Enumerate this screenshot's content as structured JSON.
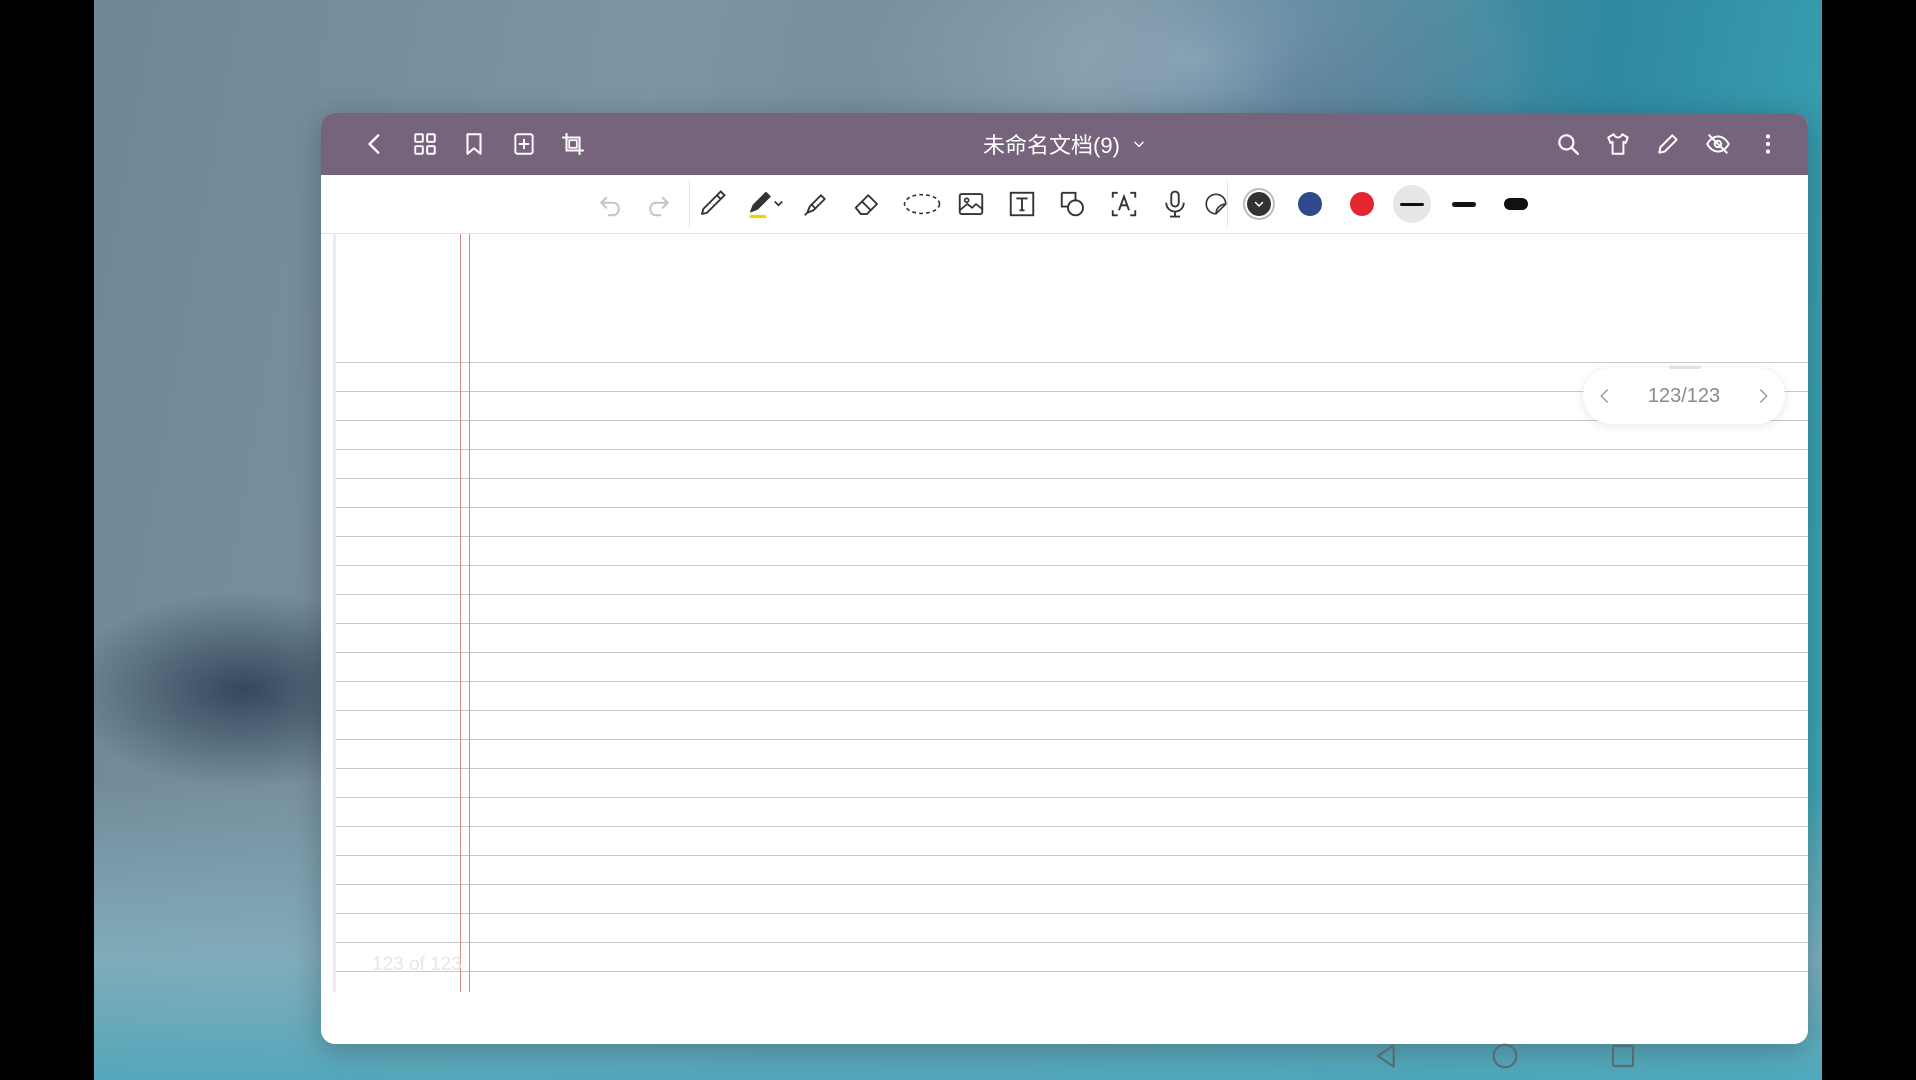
{
  "document": {
    "title": "未命名文档(9)"
  },
  "pager": {
    "current": "123",
    "separator": "/",
    "total": "123"
  },
  "page": {
    "footer_label": "123 of 123"
  },
  "toolbar": {
    "colors": [
      {
        "name": "black",
        "hex": "#333333",
        "selected": true
      },
      {
        "name": "blue",
        "hex": "#2f4a8a",
        "selected": false
      },
      {
        "name": "red",
        "hex": "#e5262e",
        "selected": false
      }
    ],
    "stroke_widths": [
      "thin",
      "medium",
      "thick"
    ],
    "selected_stroke_width": "thin"
  },
  "theme": {
    "titlebar": "#76637c",
    "margin_line": "#d88a8a",
    "rule_line": "#c8c8c8"
  }
}
